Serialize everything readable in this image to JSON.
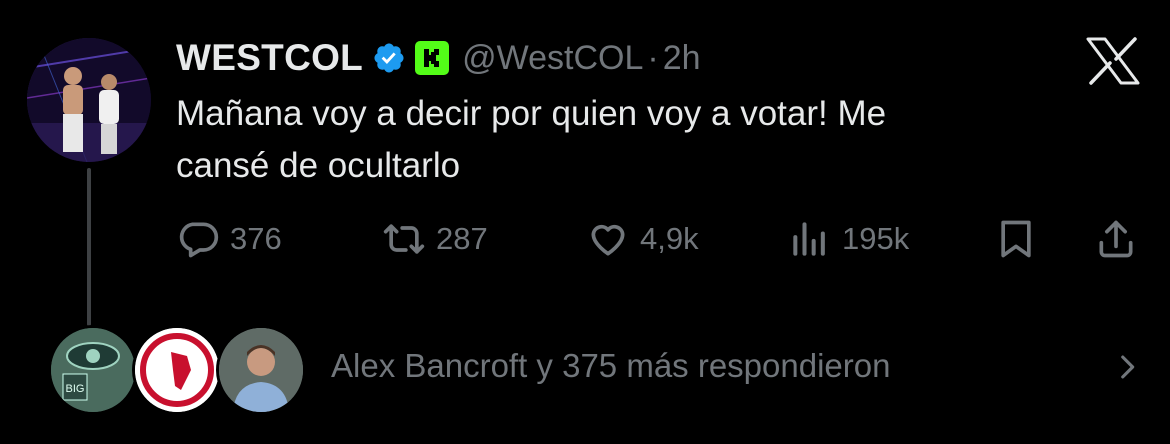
{
  "tweet": {
    "display_name": "WESTCOL",
    "handle": "@WestCOL",
    "separator": "·",
    "time": "2h",
    "text": "Mañana voy a decir por quien voy a votar! Me\ncansé de ocultarlo",
    "badges": [
      "verified-icon",
      "kick-icon"
    ],
    "platform_icon": "x-logo-icon"
  },
  "actions": {
    "replies": "376",
    "retweets": "287",
    "likes": "4,9k",
    "views": "195k"
  },
  "replies_preview": {
    "avatars": [
      "big-brother-avatar",
      "america-fc-avatar",
      "person-avatar"
    ],
    "text": "Alex Bancroft y 375 más respondieron"
  },
  "colors": {
    "background": "#000000",
    "text": "#e7e9ea",
    "muted": "#71767b",
    "verified": "#1d9bf0",
    "kick": "#53fc18"
  }
}
